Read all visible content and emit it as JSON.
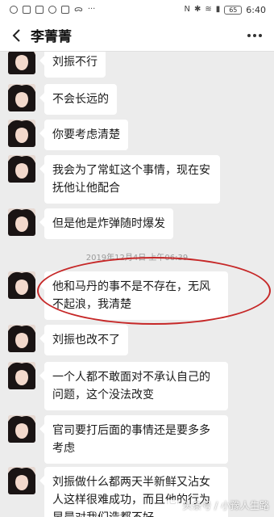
{
  "status_bar": {
    "battery": "65",
    "time": "6:40",
    "network_label": "N"
  },
  "header": {
    "back_label": "<",
    "contact_name": "李菁菁"
  },
  "messages": [
    {
      "text": "刘振不行"
    },
    {
      "text": "不会长远的"
    },
    {
      "text": "你要考虑清楚"
    },
    {
      "text": "我会为了常虹这个事情，现在安抚他让他配合"
    },
    {
      "text": "但是他是炸弹随时爆发"
    },
    {
      "text": "他和马丹的事不是不存在，无风不起浪，我清楚"
    },
    {
      "text": "刘振也改不了"
    },
    {
      "text": "一个人都不敢面对不承认自己的问题，这个没法改变"
    },
    {
      "text": "官司要打后面的事情还是要多多考虑"
    },
    {
      "text": "刘振做什么都两天半新鲜又沾女人这样很难成功，而且他的行为早晨对我们造都不好"
    }
  ],
  "timestamp": "2019年12月4日 上午06:39",
  "watermark": "头条号 / 小豫人生路",
  "colors": {
    "chat_bg": "#ececec",
    "bubble": "#ffffff",
    "highlight": "#c62828"
  }
}
